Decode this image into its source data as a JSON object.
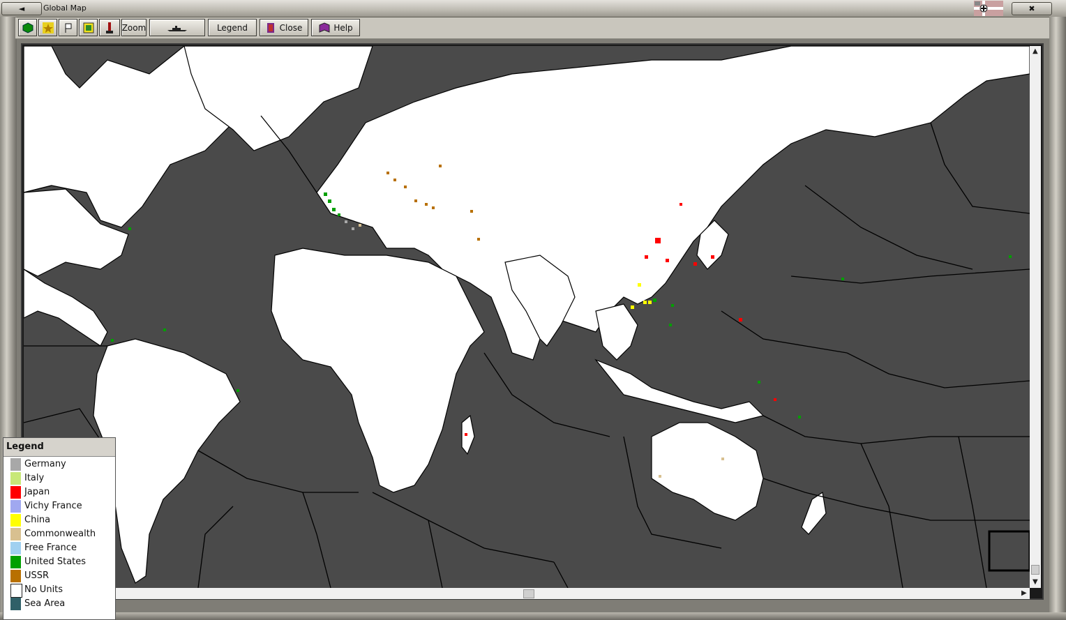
{
  "window": {
    "title": "Global Map",
    "restore_label": "◄",
    "close_label": "✖"
  },
  "toolbar": {
    "zoom_label": "Zoom",
    "legend_label": "Legend",
    "close_label": "Close",
    "help_label": "Help",
    "icons": [
      "green-hex-icon",
      "star-icon",
      "flag-icon",
      "display-icon",
      "pawn-icon",
      "ship-icon",
      "close-door-icon",
      "book-icon"
    ]
  },
  "legend": {
    "title": "Legend",
    "items": [
      {
        "label": "Germany",
        "color": "#a8a8a8"
      },
      {
        "label": "Italy",
        "color": "#c8e878"
      },
      {
        "label": "Japan",
        "color": "#ff0000"
      },
      {
        "label": "Vichy France",
        "color": "#a0a8f0"
      },
      {
        "label": "China",
        "color": "#ffff00"
      },
      {
        "label": "Commonwealth",
        "color": "#d8c090"
      },
      {
        "label": "Free France",
        "color": "#a0d0f0"
      },
      {
        "label": "United States",
        "color": "#00a000"
      },
      {
        "label": "USSR",
        "color": "#b87000"
      },
      {
        "label": "No Units",
        "color": "#ffffff"
      },
      {
        "label": "Sea Area",
        "color": "#306068"
      }
    ]
  },
  "colors": {
    "sea": "#4a4a4a",
    "land": "#ffffff",
    "border": "#000000"
  }
}
